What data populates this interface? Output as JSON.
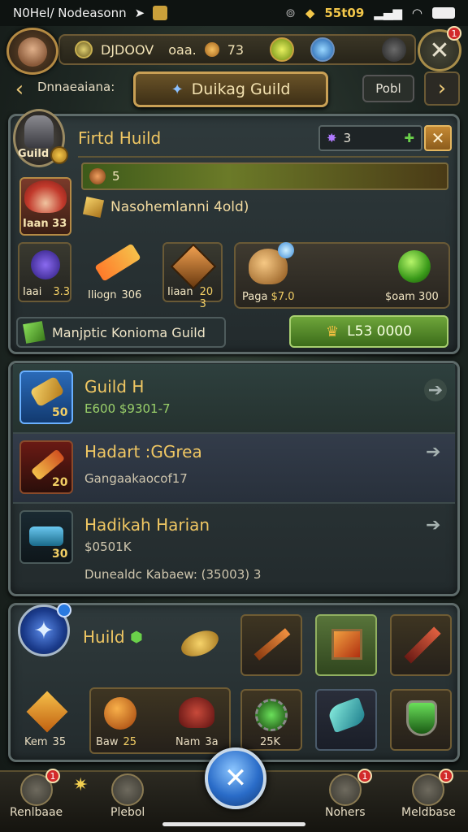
{
  "status_bar": {
    "carrier": "N0Hel/ Nodeasonn",
    "coin": "55t09"
  },
  "resources": {
    "label": "DJDOOV",
    "amount_label": "oaa.",
    "amount": "73"
  },
  "nav": {
    "left_label": "Dnnaeaiana:",
    "title": "Duikag Guild",
    "right_button": "Pobl"
  },
  "guild": {
    "title": "Firtd Huild",
    "emblem_label": "Guild",
    "gems": "3",
    "xp_value": "5",
    "guild_name": "Nasohemlanni 4old)",
    "hero_label": "Iaan 33",
    "items": [
      {
        "label": "Iaai",
        "value": "3.3"
      },
      {
        "label": "Iliogn",
        "value": "306"
      },
      {
        "label": "Iiaan",
        "value": "20 3"
      },
      {
        "label": "Paga",
        "value": "$7.0"
      },
      {
        "label": "$oam",
        "value": "300"
      }
    ],
    "join_label": "Manjptic Konioma Guild",
    "buy_button": "L53 0000"
  },
  "list": [
    {
      "title": "Guild H",
      "sub": "E600  $9301-7",
      "level": "50"
    },
    {
      "title": "Hadart :GGrea",
      "sub": "Gangaakaocof17",
      "level": "20"
    },
    {
      "title": "Hadikah Harian",
      "sub": "$0501K",
      "sub2": "Dunealdc Kabaew: (35003) 3",
      "level": "30"
    }
  ],
  "inventory": {
    "title": "Huild",
    "bottom_items": [
      {
        "label": "Kem",
        "value": "35"
      },
      {
        "label": "Baw",
        "value": "25"
      },
      {
        "label": "Nam",
        "value": "3a"
      },
      {
        "label": "",
        "value": "25K"
      }
    ]
  },
  "bottom_nav": [
    {
      "label": "Renlbaae",
      "badge": "1"
    },
    {
      "label": "Plebol",
      "badge": ""
    },
    {
      "label": "Nohers",
      "badge": "1"
    },
    {
      "label": "Meldbase",
      "badge": "1"
    }
  ],
  "badges": {
    "close": "1",
    "nav_left": "1"
  },
  "colors": {
    "accent_gold": "#f0c763",
    "panel": "#2f3a3c",
    "green_button": "#6ea53a",
    "blue_orb": "#2a6cc8"
  }
}
